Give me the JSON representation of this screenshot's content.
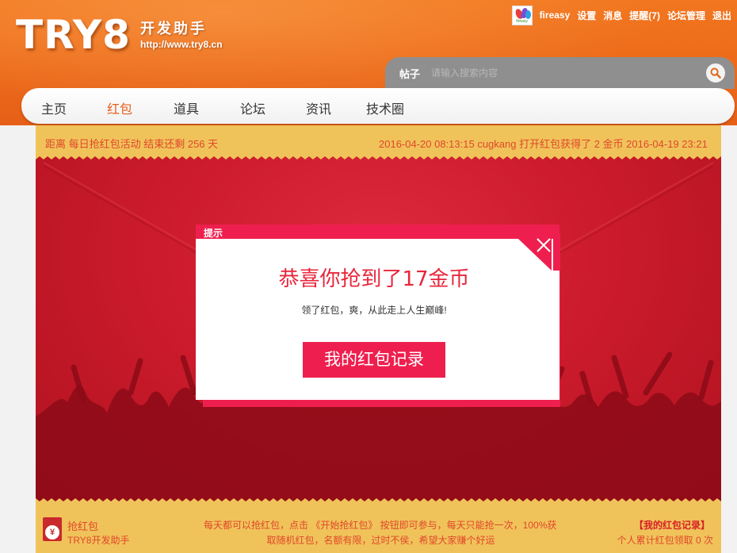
{
  "header": {
    "logo_text": "TRY8",
    "logo_cn": "开发助手",
    "logo_url": "http://www.try8.cn",
    "avatar_caption": "fireasy",
    "topbar": {
      "username": "fireasy",
      "settings": "设置",
      "messages": "消息",
      "reminders": "提醒(7)",
      "forum_admin": "论坛管理",
      "logout": "退出"
    },
    "search": {
      "type_label": "帖子",
      "placeholder": "请输入搜索内容"
    },
    "nav": [
      {
        "label": "主页"
      },
      {
        "label": "红包"
      },
      {
        "label": "道具"
      },
      {
        "label": "论坛"
      },
      {
        "label": "资讯"
      },
      {
        "label": "技术圈"
      }
    ]
  },
  "notice": {
    "countdown": "距离 每日抢红包活动 结束还剩 256 天",
    "ticker": "2016-04-20 08:13:15  cugkang  打开红包获得了  2  金币     2016-04-19 23:21"
  },
  "modal": {
    "title": "提示",
    "headline": "恭喜你抢到了17金币",
    "subtitle": "领了红包，爽，从此走上人生巅峰!",
    "button": "我的红包记录"
  },
  "footer": {
    "icon_glyph": "¥",
    "title": "抢红包",
    "subtitle": "TRY8开发助手",
    "desc_line1": "每天都可以抢红包，点击 《开始抢红包》 按钮即可参与，每天只能抢一次，100%获",
    "desc_line2": "取随机红包，名额有限，过时不侯，希望大家赚个好运",
    "my_records": "【我的红包记录】",
    "count_text": "个人累计红包领取 0 次"
  },
  "colors": {
    "header_orange": "#ec6a1a",
    "nav_active": "#e85e1c",
    "notice_yellow": "#f0c35a",
    "envelope_red": "#cc1b2c",
    "modal_accent": "#ee1f4e",
    "notice_text": "#e0472a"
  }
}
